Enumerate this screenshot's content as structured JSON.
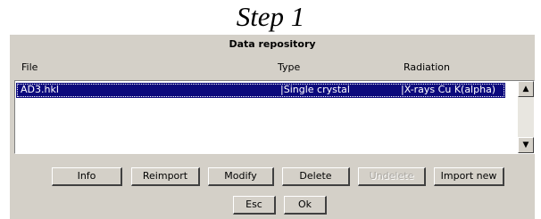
{
  "caption": "Step 1",
  "window": {
    "title": "Data repository"
  },
  "columns": {
    "file": "File",
    "type": "Type",
    "radiation": "Radiation"
  },
  "rows": [
    {
      "file": "AD3.hkl",
      "type": "|Single crystal",
      "radiation": "|X-rays Cu K(alpha)",
      "selected": true
    }
  ],
  "scrollbar": {
    "up_icon": "arrow-up",
    "down_icon": "arrow-down"
  },
  "buttons": {
    "info": "Info",
    "reimport": "Reimport",
    "modify": "Modify",
    "delete": "Delete",
    "undelete": "Undelete",
    "import_new": "Import new",
    "esc": "Esc",
    "ok": "Ok"
  },
  "colors": {
    "selection": "#0c0a7c",
    "dialog_bg": "#d4d0c8"
  }
}
